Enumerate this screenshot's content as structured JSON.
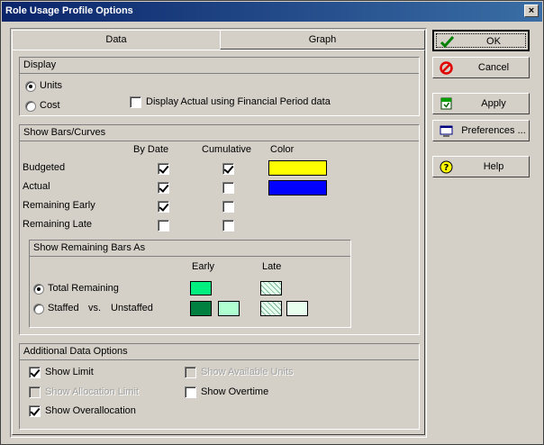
{
  "window": {
    "title": "Role Usage Profile Options"
  },
  "tabs": [
    "Data",
    "Graph"
  ],
  "display": {
    "header": "Display",
    "units_label": "Units",
    "cost_label": "Cost",
    "units_selected": true,
    "display_actual_label": "Display Actual using Financial Period data",
    "display_actual_checked": false
  },
  "bars": {
    "header": "Show Bars/Curves",
    "col_by_date": "By Date",
    "col_cumulative": "Cumulative",
    "col_color": "Color",
    "rows": [
      {
        "label": "Budgeted",
        "by_date": true,
        "cumulative": true,
        "color": "#ffff00"
      },
      {
        "label": "Actual",
        "by_date": true,
        "cumulative": false,
        "color": "#0000ff"
      },
      {
        "label": "Remaining Early",
        "by_date": true,
        "cumulative": false
      },
      {
        "label": "Remaining Late",
        "by_date": false,
        "cumulative": false
      }
    ]
  },
  "remaining": {
    "header": "Show Remaining Bars As",
    "col_early": "Early",
    "col_late": "Late",
    "total_label": "Total Remaining",
    "staffed_label": "Staffed",
    "vs_label": "vs.",
    "unstaffed_label": "Unstaffed",
    "total_selected": true,
    "colors": {
      "early_total": "#00f080",
      "early_staffed": "#008040",
      "early_unstaffed": "#b0ffd0"
    }
  },
  "additional": {
    "header": "Additional Data Options",
    "show_limit": "Show Limit",
    "show_limit_checked": true,
    "show_available_units": "Show Available Units",
    "show_allocation_limit": "Show Allocation Limit",
    "show_overtime": "Show Overtime",
    "show_overtime_checked": false,
    "show_overallocation": "Show Overallocation",
    "show_overallocation_checked": true
  },
  "buttons": {
    "ok": "OK",
    "cancel": "Cancel",
    "apply": "Apply",
    "preferences": "Preferences ...",
    "help": "Help"
  }
}
